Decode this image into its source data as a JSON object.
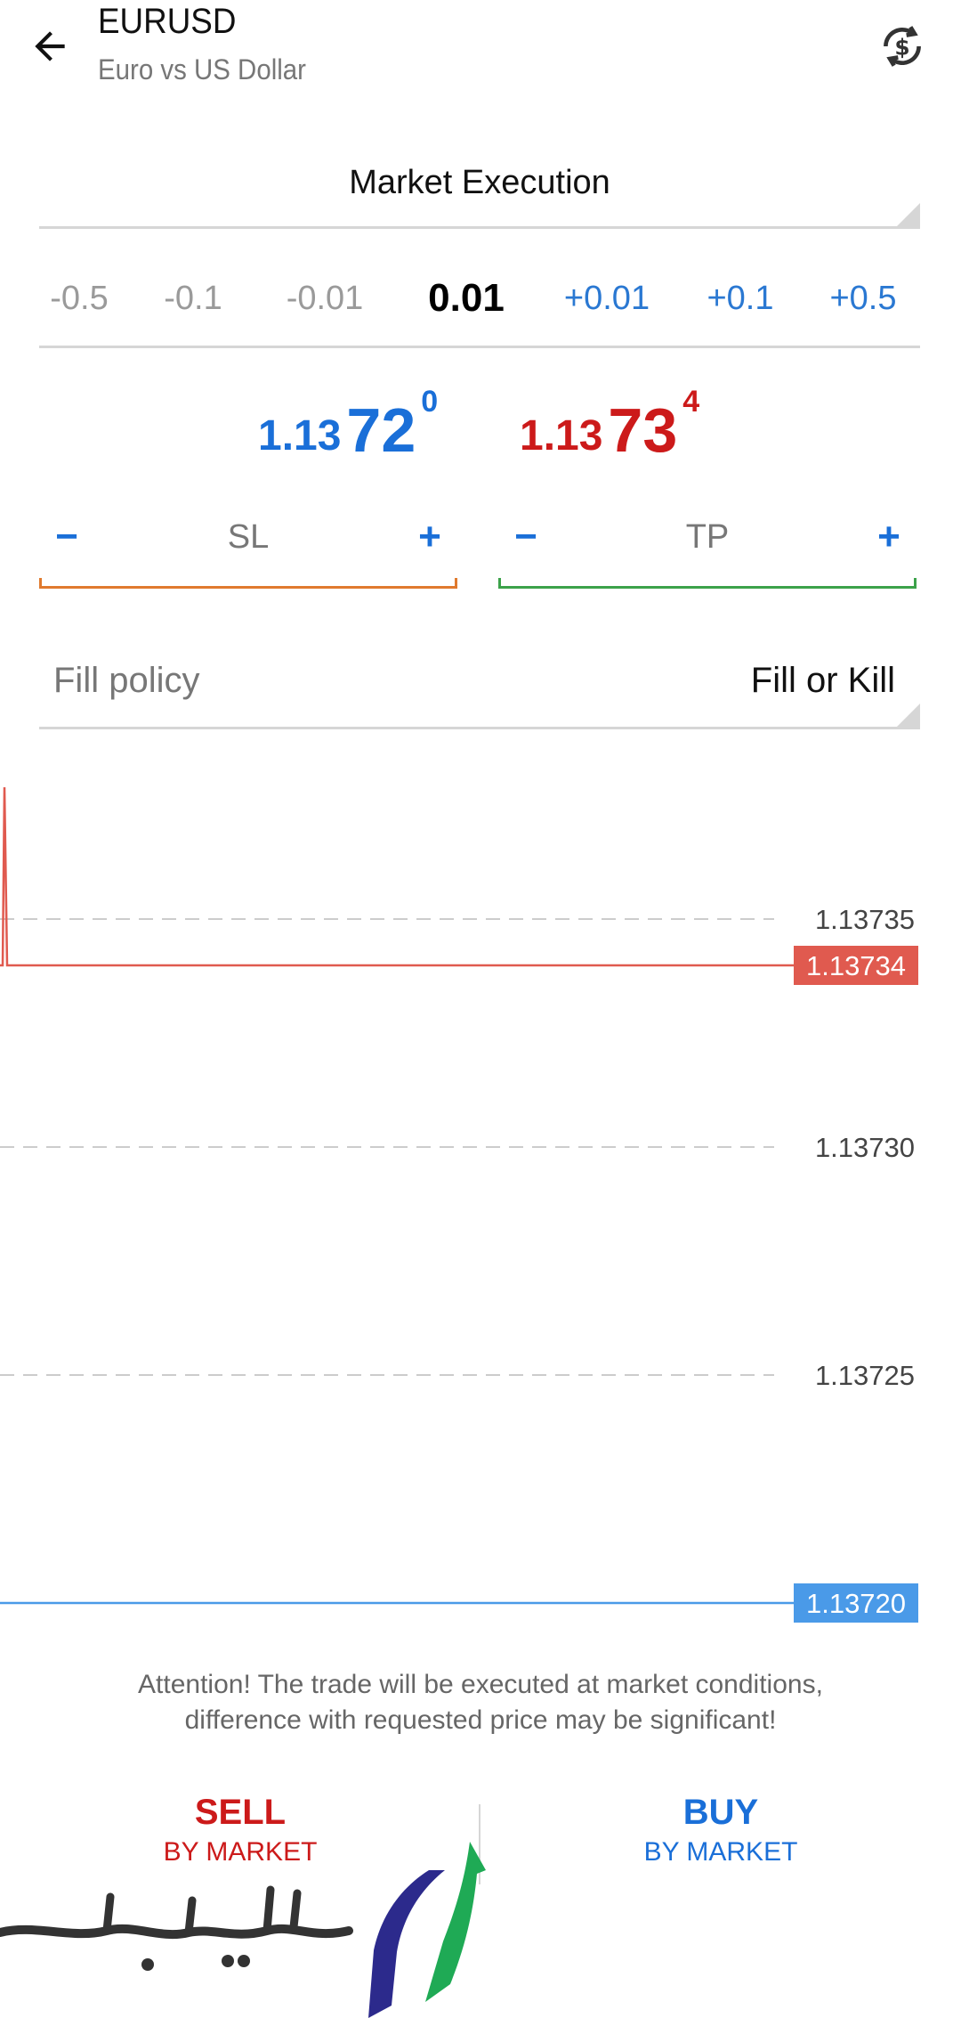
{
  "header": {
    "symbol": "EURUSD",
    "description": "Euro vs US Dollar",
    "back_icon": "arrow-left-icon",
    "sync_icon": "currency-sync-icon"
  },
  "order_type": {
    "label": "Market Execution"
  },
  "volume": {
    "steps": [
      "-0.5",
      "-0.1",
      "-0.01",
      "+0.01",
      "+0.1",
      "+0.5"
    ],
    "current": "0.01"
  },
  "prices": {
    "bid": {
      "prefix": "1.13",
      "big": "72",
      "sup": "0",
      "color": "#1a6fd8"
    },
    "ask": {
      "prefix": "1.13",
      "big": "73",
      "sup": "4",
      "color": "#cc1a1a"
    }
  },
  "sl": {
    "label": "SL",
    "minus": "−",
    "plus": "+"
  },
  "tp": {
    "label": "TP",
    "minus": "−",
    "plus": "+"
  },
  "fill_policy": {
    "label": "Fill policy",
    "value": "Fill or Kill"
  },
  "chart_data": {
    "type": "line",
    "y_ticks": [
      "1.13735",
      "1.13730",
      "1.13725"
    ],
    "ask_line": {
      "value": "1.13734",
      "color": "#e05a4f"
    },
    "bid_line": {
      "value": "1.13720",
      "color": "#4a9ae8"
    }
  },
  "attention": {
    "line1": "Attention! The trade will be executed at market conditions,",
    "line2": "difference with requested price may be significant!"
  },
  "buttons": {
    "sell": {
      "main": "SELL",
      "sub": "BY MARKET"
    },
    "buy": {
      "main": "BUY",
      "sub": "BY MARKET"
    }
  },
  "watermark": {
    "text": "پارسیان بورس"
  }
}
